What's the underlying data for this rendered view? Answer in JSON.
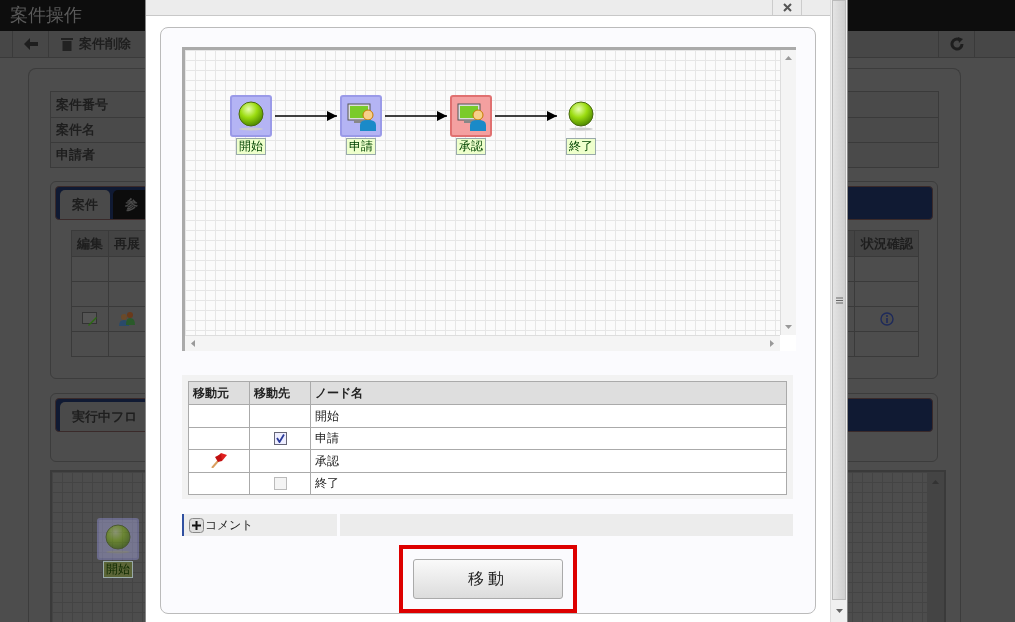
{
  "page": {
    "title": "案件操作",
    "toolbar": {
      "delete_button": "案件削除"
    },
    "info_rows": [
      "案件番号",
      "案件名",
      "申請者"
    ],
    "tabs": [
      {
        "label": "案件",
        "selected": true
      },
      {
        "label": "参",
        "selected": false
      }
    ],
    "matter_table": {
      "columns": [
        "編集",
        "再展",
        "状況確認"
      ],
      "rows": [
        {
          "has_actions": false
        },
        {
          "has_actions": false
        },
        {
          "has_actions": true
        },
        {
          "has_actions": false
        }
      ]
    },
    "flow_tab": {
      "label": "実行中フロ",
      "selected": true
    },
    "flow_nodes": [
      {
        "label": "開始",
        "kind": "start",
        "passed": true,
        "current": false
      }
    ]
  },
  "dialog": {
    "flow": {
      "nodes": [
        {
          "label": "開始",
          "kind": "start",
          "passed": true,
          "current": false
        },
        {
          "label": "申請",
          "kind": "task",
          "passed": true,
          "current": false
        },
        {
          "label": "承認",
          "kind": "task",
          "passed": false,
          "current": true
        },
        {
          "label": "終了",
          "kind": "end",
          "passed": false,
          "current": false
        }
      ]
    },
    "node_table": {
      "columns": [
        "移動元",
        "移動先",
        "ノード名"
      ],
      "rows": [
        {
          "is_source": false,
          "checkable": false,
          "name": "開始"
        },
        {
          "is_source": false,
          "checkable": true,
          "checked": true,
          "name": "申請"
        },
        {
          "is_source": true,
          "checkable": false,
          "name": "承認"
        },
        {
          "is_source": false,
          "checkable": true,
          "checked": false,
          "name": "終了"
        }
      ]
    },
    "comment": {
      "label": "コメント",
      "expanded": false
    },
    "move_button": {
      "label": "移動",
      "highlighted": true
    }
  }
}
